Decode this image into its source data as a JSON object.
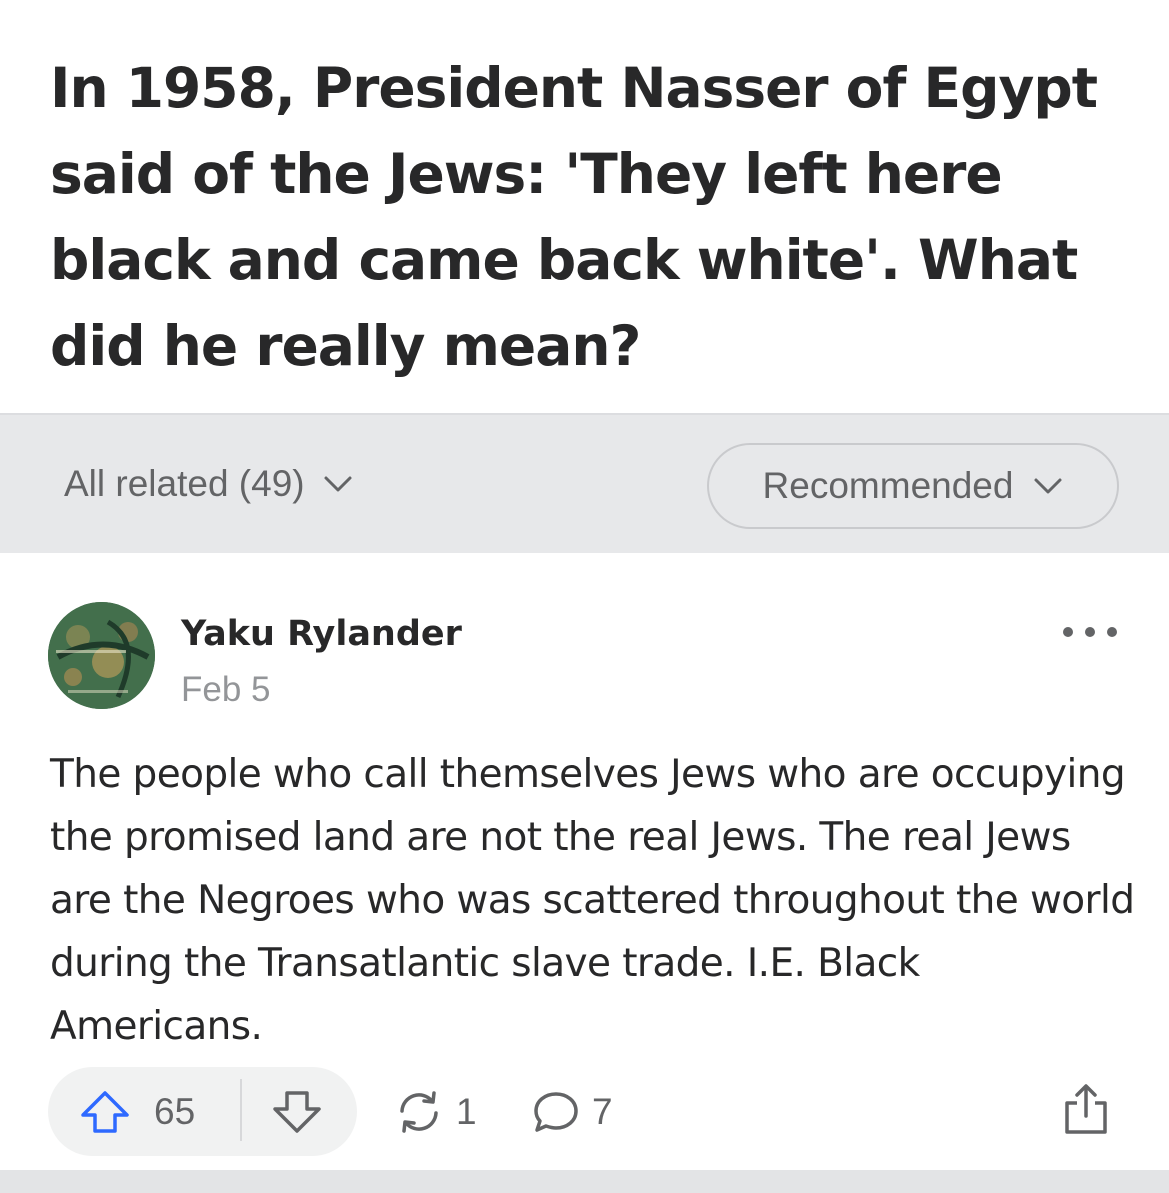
{
  "question": {
    "title": "In 1958, President Nasser of Egypt said of the Jews: 'They left here black and came back white'. What did he really mean?"
  },
  "filters": {
    "all_related_label": "All related (49)",
    "sort_label": "Recommended",
    "chevron_icon": "chevron-down-icon"
  },
  "answer": {
    "author": {
      "name": "Yaku Rylander",
      "date": "Feb 5",
      "avatar_icon": "avatar"
    },
    "more_icon": "more-dots-icon",
    "text": "The people who call themselves Jews who are occupying the promised land are not the real Jews. The real Jews are the Negroes who was scattered throughout the world during the Transatlantic slave trade. I.E. Black Americans.",
    "actions": {
      "upvotes": "65",
      "shares": "1",
      "comments": "7",
      "upvote_icon": "upvote-arrow-icon",
      "downvote_icon": "downvote-arrow-icon",
      "share_icon": "reshare-icon",
      "comment_icon": "comment-bubble-icon",
      "export_icon": "share-export-icon"
    }
  },
  "colors": {
    "text_primary": "#282829",
    "text_secondary": "#636466",
    "text_muted": "#939598",
    "filter_bar_bg": "#e7e8ea",
    "upvote_blue": "#2e69ff",
    "pill_bg": "#f1f2f2"
  }
}
